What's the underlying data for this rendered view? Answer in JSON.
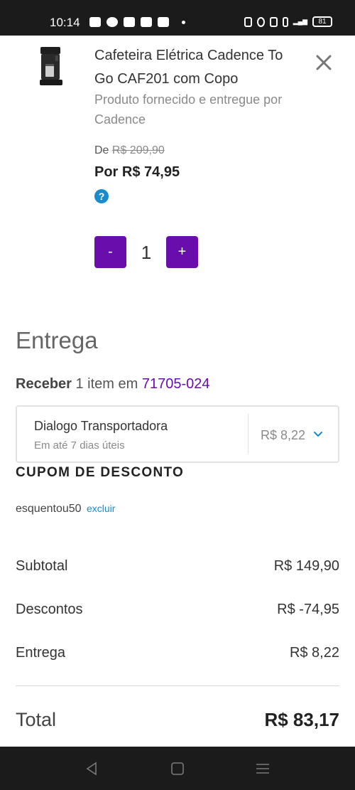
{
  "status_bar": {
    "time": "10:14",
    "battery": "81"
  },
  "product": {
    "title": "Cafeteira Elétrica Cadence To Go CAF201 com Copo",
    "seller": "Produto fornecido e entregue por Cadence",
    "price_old_prefix": "De",
    "price_old": "R$ 209,90",
    "price_new": "Por R$ 74,95",
    "help_symbol": "?",
    "quantity": "1",
    "minus_label": "-",
    "plus_label": "+",
    "icon": "coffee-maker-image"
  },
  "delivery": {
    "title": "Entrega",
    "receive_bold": "Receber",
    "receive_text": " 1 item em ",
    "cep": "71705-024",
    "option": {
      "name": "Dialogo Transportadora",
      "eta": "Em até 7 dias úteis",
      "price": "R$ 8,22"
    }
  },
  "coupon": {
    "title": "CUPOM DE DESCONTO",
    "code": "esquentou50",
    "remove_label": "excluir"
  },
  "summary": {
    "subtotal_label": "Subtotal",
    "subtotal_value": "R$ 149,90",
    "discount_label": "Descontos",
    "discount_value": "R$ -74,95",
    "delivery_label": "Entrega",
    "delivery_value": "R$ 8,22",
    "total_label": "Total",
    "total_value": "R$ 83,17"
  },
  "colors": {
    "accent": "#6a0dad",
    "link": "#1a8ccc"
  }
}
